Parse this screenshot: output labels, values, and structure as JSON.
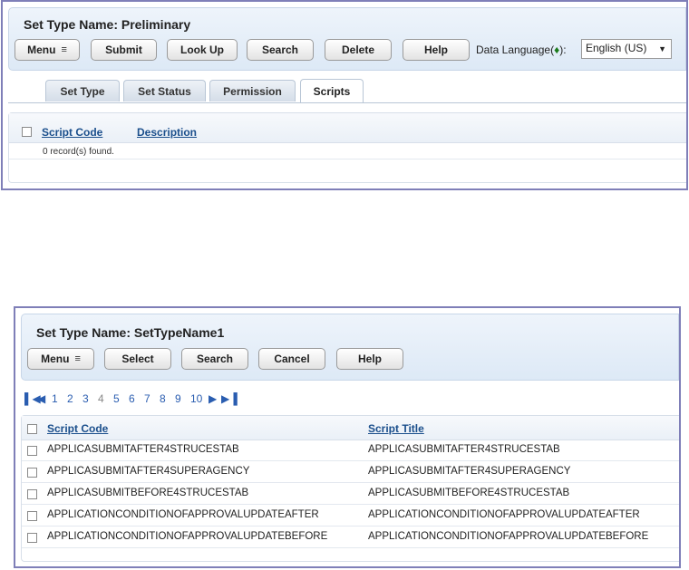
{
  "panel1": {
    "title": "Set Type Name: Preliminary",
    "buttons": {
      "menu": "Menu",
      "submit": "Submit",
      "lookup": "Look Up",
      "search": "Search",
      "delete": "Delete",
      "help": "Help"
    },
    "data_language_label": "Data Language(",
    "data_language_diamond": "♦",
    "data_language_suffix": "):",
    "data_language_value": "English (US)",
    "tabs": [
      "Set Type",
      "Set Status",
      "Permission",
      "Scripts"
    ],
    "active_tab": "Scripts",
    "columns": [
      "Script Code",
      "Description"
    ],
    "records_text": "0 record(s) found."
  },
  "panel2": {
    "title": "Set Type Name: SetTypeName1",
    "buttons": {
      "menu": "Menu",
      "select": "Select",
      "search": "Search",
      "cancel": "Cancel",
      "help": "Help"
    },
    "pager": {
      "pages": [
        "1",
        "2",
        "3",
        "4",
        "5",
        "6",
        "7",
        "8",
        "9",
        "10"
      ],
      "current": "4"
    },
    "columns": [
      "Script Code",
      "Script Title"
    ],
    "rows": [
      {
        "code": "APPLICASUBMITAFTER4STRUCESTAB",
        "title": "APPLICASUBMITAFTER4STRUCESTAB"
      },
      {
        "code": "APPLICASUBMITAFTER4SUPERAGENCY",
        "title": "APPLICASUBMITAFTER4SUPERAGENCY"
      },
      {
        "code": "APPLICASUBMITBEFORE4STRUCESTAB",
        "title": "APPLICASUBMITBEFORE4STRUCESTAB"
      },
      {
        "code": "APPLICATIONCONDITIONOFAPPROVALUPDATEAFTER",
        "title": "APPLICATIONCONDITIONOFAPPROVALUPDATEAFTER"
      },
      {
        "code": "APPLICATIONCONDITIONOFAPPROVALUPDATEBEFORE",
        "title": "APPLICATIONCONDITIONOFAPPROVALUPDATEBEFORE"
      }
    ]
  },
  "colors": {
    "accent_link": "#1b4f8c",
    "panel_border": "#7f7fb8",
    "header_bg": "#dde9f6",
    "diamond": "#1a7a1a"
  },
  "icons": {
    "menu": "menu-lines-icon",
    "dropdown": "chevron-down-icon",
    "first": "first-page-icon",
    "prev": "prev-page-icon",
    "next": "next-page-icon",
    "last": "last-page-icon"
  }
}
